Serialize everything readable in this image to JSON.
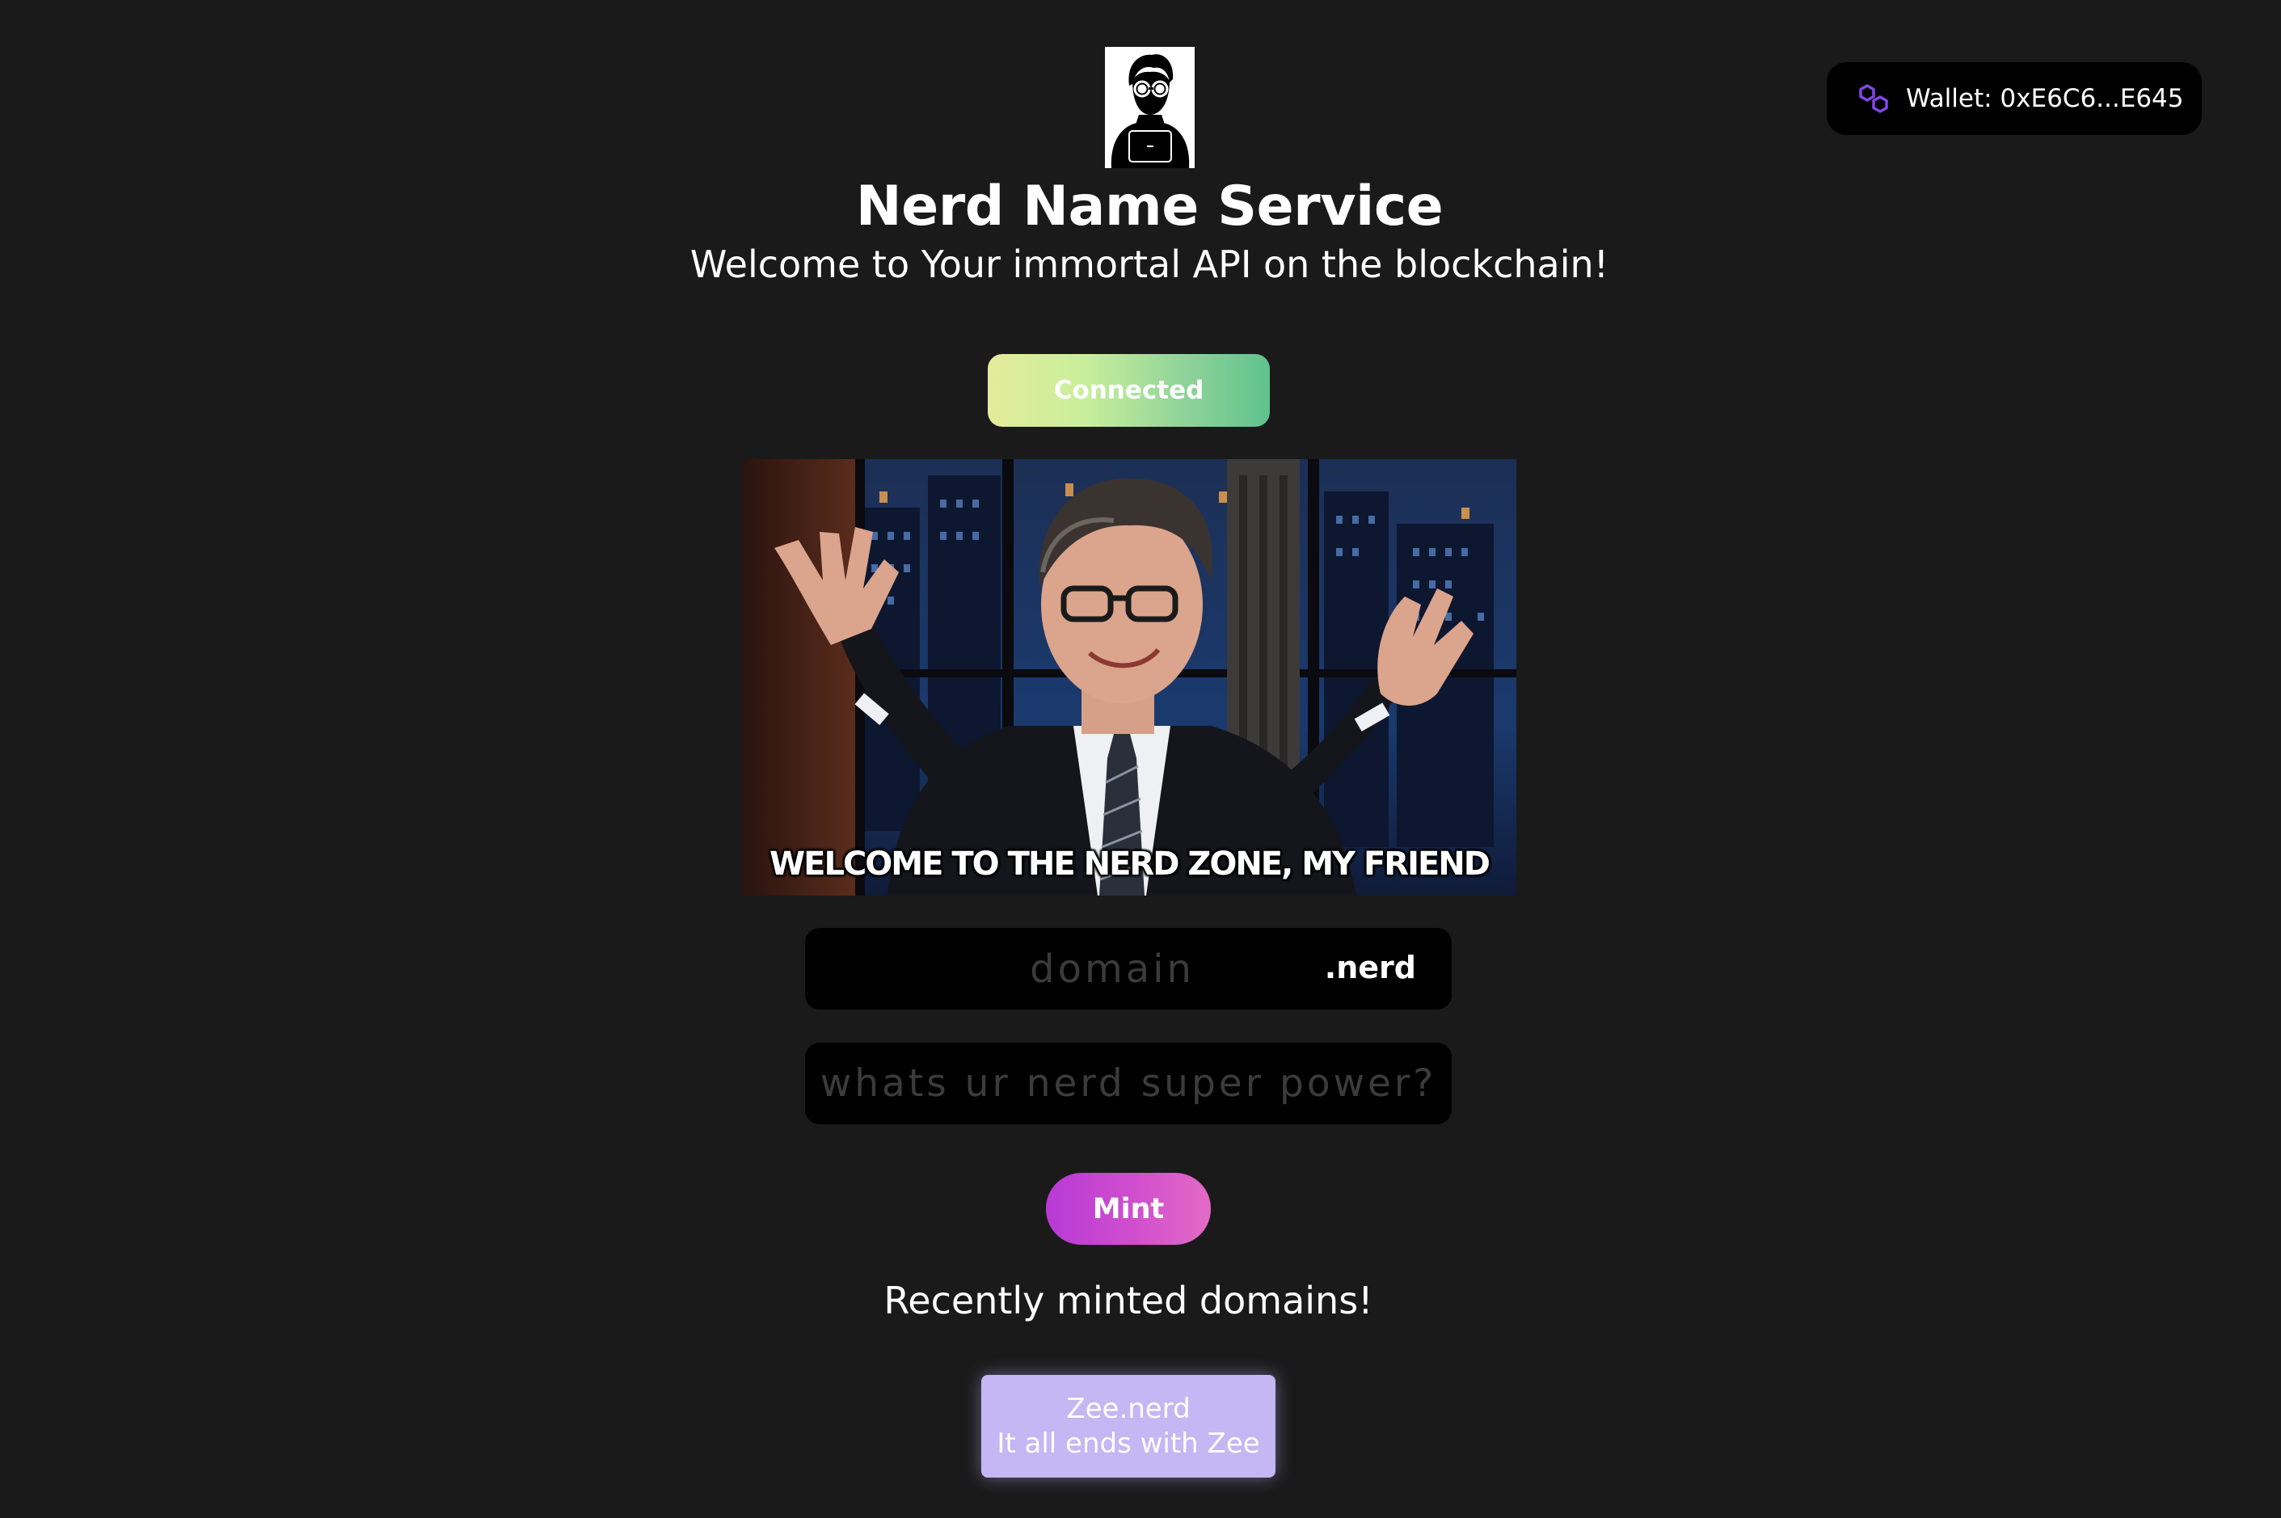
{
  "header": {
    "wallet_label": "Wallet: 0xE6C6...E645",
    "wallet_icon": "polygon-icon",
    "logo_icon": "nerd-avatar-icon",
    "title": "Nerd Name Service",
    "subtitle": "Welcome to Your immortal API on the blockchain!"
  },
  "connect": {
    "label": "Connected"
  },
  "gif": {
    "caption": "WELCOME TO THE NERD ZONE, MY FRIEND"
  },
  "form": {
    "domain_placeholder": "domain",
    "domain_value": "",
    "tld": ".nerd",
    "power_placeholder": "whats ur nerd super power?",
    "power_value": "",
    "mint_label": "Mint"
  },
  "recent": {
    "heading": "Recently minted domains!",
    "items": [
      {
        "name": "Zee.nerd",
        "record": "It all ends with Zee"
      }
    ]
  },
  "colors": {
    "background": "#1a1a1a",
    "field_background": "#000000",
    "mint_gradient": [
      "#b83ad6",
      "#e36bc6"
    ],
    "connected_gradient": [
      "#e3ec9a",
      "#60c28d"
    ],
    "card_color": "#c4b7f3",
    "polygon_purple": "#8247e5"
  }
}
